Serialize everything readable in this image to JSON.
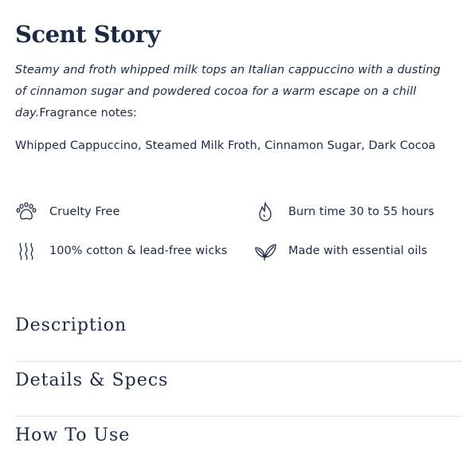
{
  "scent_story": {
    "title": "Scent Story",
    "description_italic": "Steamy and froth whipped milk tops an Italian cappuccino with a dusting of cinnamon sugar and powdered cocoa for a warm escape on a chill day.",
    "notes_label": "Fragrance notes:",
    "notes": "Whipped Cappuccino, Steamed Milk Froth, Cinnamon Sugar, Dark Cocoa"
  },
  "features": [
    {
      "icon": "paw-icon",
      "label": "Cruelty Free"
    },
    {
      "icon": "flame-icon",
      "label": "Burn time 30 to 55 hours"
    },
    {
      "icon": "wick-icon",
      "label": "100% cotton & lead-free wicks"
    },
    {
      "icon": "leaf-icon",
      "label": "Made with essential oils"
    }
  ],
  "accordion": [
    {
      "label": "Description"
    },
    {
      "label": "Details & Specs"
    },
    {
      "label": "How To Use"
    }
  ],
  "colors": {
    "text": "#1c2a44",
    "divider": "#e2e4e8",
    "background": "#ffffff"
  }
}
